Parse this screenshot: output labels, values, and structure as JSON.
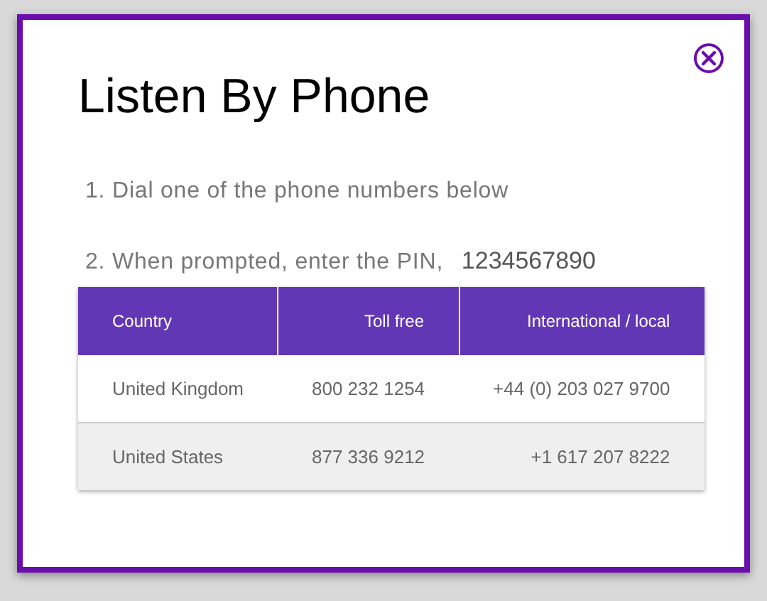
{
  "dialog": {
    "title": "Listen By Phone"
  },
  "steps": [
    {
      "text": "1. Dial one of the phone numbers below"
    },
    {
      "text": "2. When prompted, enter the PIN,",
      "value": "1234567890"
    }
  ],
  "table": {
    "columns": [
      "Country",
      "Toll free",
      "International / local"
    ],
    "rows": [
      [
        "United Kingdom",
        "800 232 1254",
        "+44 (0) 203 027 9700"
      ],
      [
        "United States",
        "877 336 9212",
        "+1 617 207 8222"
      ]
    ]
  }
}
